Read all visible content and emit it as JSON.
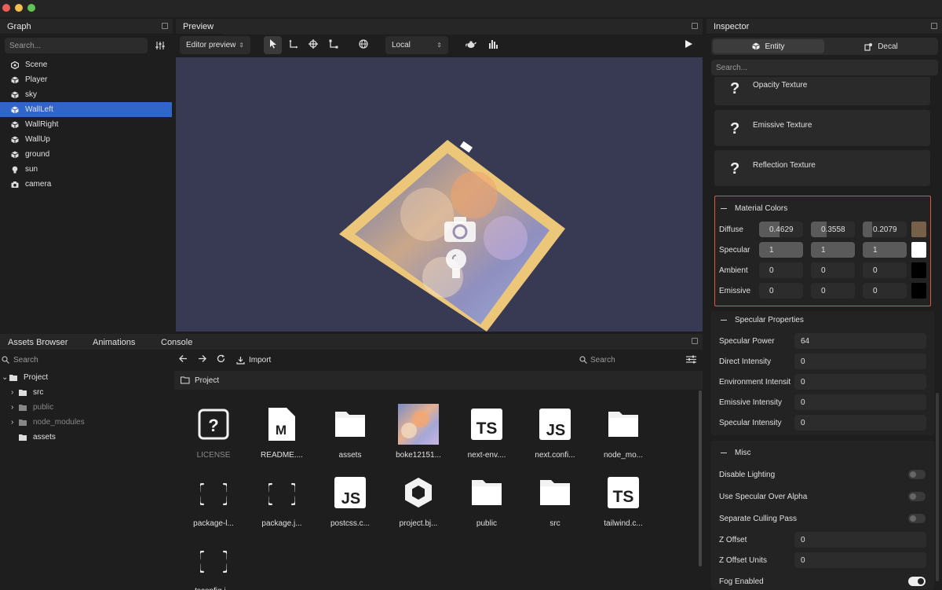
{
  "graph": {
    "title": "Graph",
    "search_placeholder": "Search...",
    "items": [
      {
        "label": "Scene",
        "icon": "scene-icon"
      },
      {
        "label": "Player",
        "icon": "cube-icon"
      },
      {
        "label": "sky",
        "icon": "cube-icon"
      },
      {
        "label": "WallLeft",
        "icon": "cube-icon",
        "selected": true
      },
      {
        "label": "WallRight",
        "icon": "cube-icon"
      },
      {
        "label": "WallUp",
        "icon": "cube-icon"
      },
      {
        "label": "ground",
        "icon": "cube-icon"
      },
      {
        "label": "sun",
        "icon": "light-bulb-icon"
      },
      {
        "label": "camera",
        "icon": "camera-icon"
      }
    ]
  },
  "preview": {
    "title": "Preview",
    "mode_dropdown": "Editor preview",
    "space_dropdown": "Local",
    "viewport_color": "#383a54"
  },
  "inspector": {
    "title": "Inspector",
    "tabs": {
      "entity": "Entity",
      "decal": "Decal"
    },
    "search_placeholder": "Search...",
    "textures": [
      "Opacity Texture",
      "Emissive Texture",
      "Reflection Texture"
    ],
    "material_colors": {
      "title": "Material Colors",
      "rows": [
        {
          "label": "Diffuse",
          "values": [
            "0.4629",
            "0.3558",
            "0.2079"
          ],
          "swatch": "#766148"
        },
        {
          "label": "Specular",
          "values": [
            "1",
            "1",
            "1"
          ],
          "swatch": "#ffffff"
        },
        {
          "label": "Ambient",
          "values": [
            "0",
            "0",
            "0"
          ],
          "swatch": "#000000"
        },
        {
          "label": "Emissive",
          "values": [
            "0",
            "0",
            "0"
          ],
          "swatch": "#000000"
        }
      ]
    },
    "specular_properties": {
      "title": "Specular Properties",
      "rows": [
        {
          "label": "Specular Power",
          "value": "64"
        },
        {
          "label": "Direct Intensity",
          "value": "0"
        },
        {
          "label": "Environment Intensit",
          "value": "0"
        },
        {
          "label": "Emissive Intensity",
          "value": "0"
        },
        {
          "label": "Specular Intensity",
          "value": "0"
        }
      ]
    },
    "misc": {
      "title": "Misc",
      "toggles": [
        {
          "label": "Disable Lighting",
          "on": false
        },
        {
          "label": "Use Specular Over Alpha",
          "on": false
        },
        {
          "label": "Separate Culling Pass",
          "on": false
        }
      ],
      "fields": [
        {
          "label": "Z Offset",
          "value": "0"
        },
        {
          "label": "Z Offset Units",
          "value": "0"
        }
      ],
      "fog_label": "Fog Enabled",
      "fog_on": true
    }
  },
  "bottom": {
    "tabs": [
      "Assets Browser",
      "Animations",
      "Console"
    ],
    "search_placeholder": "Search",
    "import_label": "Import",
    "search2_placeholder": "Search",
    "breadcrumb": "Project",
    "tree": [
      {
        "label": "Project",
        "expanded": true
      },
      {
        "label": "src"
      },
      {
        "label": "public",
        "dim": true
      },
      {
        "label": "node_modules",
        "dim": true
      },
      {
        "label": "assets"
      }
    ],
    "assets": [
      {
        "label": "LICENSE",
        "icon": "help-file-icon",
        "dim": true
      },
      {
        "label": "README....",
        "icon": "markdown-file-icon"
      },
      {
        "label": "assets",
        "icon": "folder-icon"
      },
      {
        "label": "boke12151...",
        "icon": "image-thumbnail"
      },
      {
        "label": "next-env....",
        "icon": "ts-file-icon"
      },
      {
        "label": "next.confi...",
        "icon": "js-file-icon"
      },
      {
        "label": "node_mo...",
        "icon": "folder-icon"
      },
      {
        "label": "package-l...",
        "icon": "json-file-icon"
      },
      {
        "label": "package.j...",
        "icon": "json-file-icon"
      },
      {
        "label": "postcss.c...",
        "icon": "js-file-icon"
      },
      {
        "label": "project.bj...",
        "icon": "babylon-project-icon"
      },
      {
        "label": "public",
        "icon": "folder-icon"
      },
      {
        "label": "src",
        "icon": "folder-icon"
      },
      {
        "label": "tailwind.c...",
        "icon": "ts-file-icon"
      },
      {
        "label": "tsconfig.j...",
        "icon": "json-file-icon"
      }
    ]
  }
}
